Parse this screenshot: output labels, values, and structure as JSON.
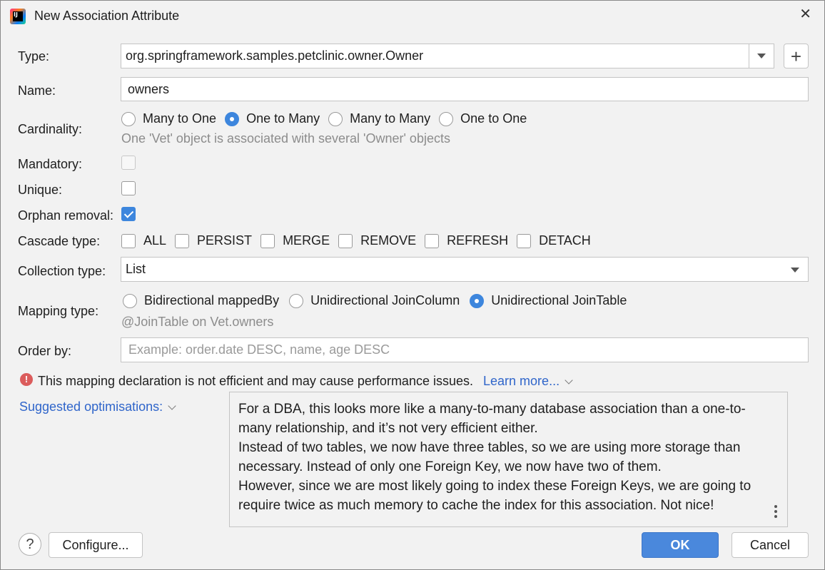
{
  "window": {
    "title": "New Association Attribute",
    "app_icon_text": "IJ"
  },
  "type": {
    "label": "Type:",
    "value": "org.springframework.samples.petclinic.owner.Owner"
  },
  "name": {
    "label": "Name:",
    "value": "owners"
  },
  "cardinality": {
    "label": "Cardinality:",
    "options": [
      "Many to One",
      "One to Many",
      "Many to Many",
      "One to One"
    ],
    "selected": "One to Many",
    "hint": "One 'Vet' object is associated with several 'Owner' objects"
  },
  "mandatory": {
    "label": "Mandatory:",
    "checked": false,
    "enabled": false
  },
  "unique": {
    "label": "Unique:",
    "checked": false
  },
  "orphan_removal": {
    "label": "Orphan removal:",
    "checked": true
  },
  "cascade": {
    "label": "Cascade type:",
    "options": [
      "ALL",
      "PERSIST",
      "MERGE",
      "REMOVE",
      "REFRESH",
      "DETACH"
    ]
  },
  "collection_type": {
    "label": "Collection type:",
    "value": "List"
  },
  "mapping_type": {
    "label": "Mapping type:",
    "options": [
      "Bidirectional mappedBy",
      "Unidirectional JoinColumn",
      "Unidirectional JoinTable"
    ],
    "selected": "Unidirectional JoinTable",
    "hint": "@JoinTable on Vet.owners"
  },
  "order_by": {
    "label": "Order by:",
    "placeholder": "Example: order.date DESC, name, age DESC"
  },
  "warning": {
    "text": "This mapping declaration is not efficient and may cause performance issues.",
    "link": "Learn more..."
  },
  "suggested": {
    "label": "Suggested optimisations:",
    "paragraphs": [
      "For a DBA, this looks more like a many-to-many database association than a one-to-many relationship, and it’s not very efficient either.",
      "Instead of two tables, we now have three tables, so we are using more storage than necessary. Instead of only one Foreign Key, we now have two of them.",
      "However, since we are most likely going to index these Foreign Keys, we are going to require twice as much memory to cache the index for this association. Not nice!"
    ]
  },
  "buttons": {
    "help": "?",
    "configure": "Configure...",
    "ok": "OK",
    "cancel": "Cancel",
    "plus": "+"
  }
}
